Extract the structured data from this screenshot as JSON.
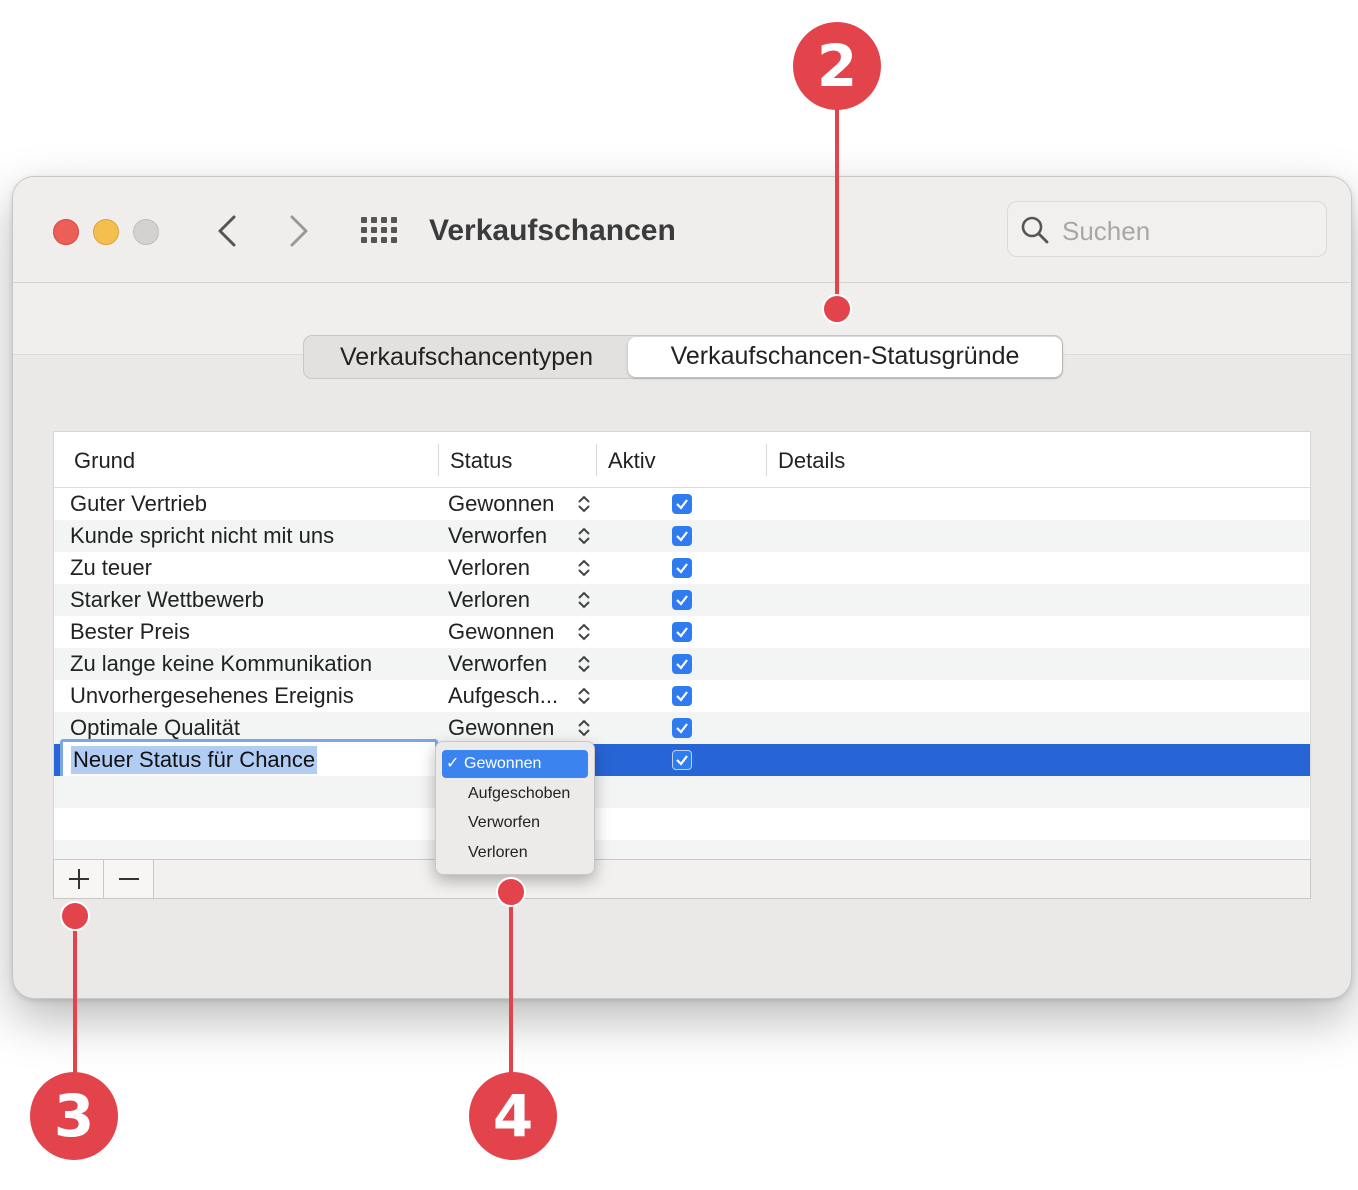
{
  "window": {
    "title": "Verkaufschancen",
    "search_placeholder": "Suchen"
  },
  "tabs": [
    {
      "label": "Verkaufschancentypen",
      "selected": false
    },
    {
      "label": "Verkaufschancen-Statusgründe",
      "selected": true
    }
  ],
  "table": {
    "columns": [
      "Grund",
      "Status",
      "Aktiv",
      "Details"
    ],
    "rows": [
      {
        "grund": "Guter Vertrieb",
        "status": "Gewonnen",
        "aktiv": true
      },
      {
        "grund": "Kunde spricht nicht mit uns",
        "status": "Verworfen",
        "aktiv": true
      },
      {
        "grund": "Zu teuer",
        "status": "Verloren",
        "aktiv": true
      },
      {
        "grund": "Starker Wettbewerb",
        "status": "Verloren",
        "aktiv": true
      },
      {
        "grund": "Bester Preis",
        "status": "Gewonnen",
        "aktiv": true
      },
      {
        "grund": "Zu lange keine Kommunikation",
        "status": "Verworfen",
        "aktiv": true
      },
      {
        "grund": "Unvorhergesehenes Ereignis",
        "status": "Aufgesch...",
        "aktiv": true
      },
      {
        "grund": "Optimale Qualität",
        "status": "Gewonnen",
        "aktiv": true
      }
    ],
    "editing_row": {
      "grund": "Neuer Status für Chance",
      "aktiv": true
    }
  },
  "status_popup": {
    "check_mark": "✓",
    "options": [
      {
        "label": "Gewonnen",
        "selected": true
      },
      {
        "label": "Aufgeschoben",
        "selected": false
      },
      {
        "label": "Verworfen",
        "selected": false
      },
      {
        "label": "Verloren",
        "selected": false
      }
    ]
  },
  "buttons": {
    "add": "+",
    "remove": "−"
  },
  "callouts": [
    "2",
    "3",
    "4"
  ],
  "colors": {
    "selection": "#2765d6",
    "checkbox": "#2f7bf0",
    "callout": "#e3444b"
  }
}
